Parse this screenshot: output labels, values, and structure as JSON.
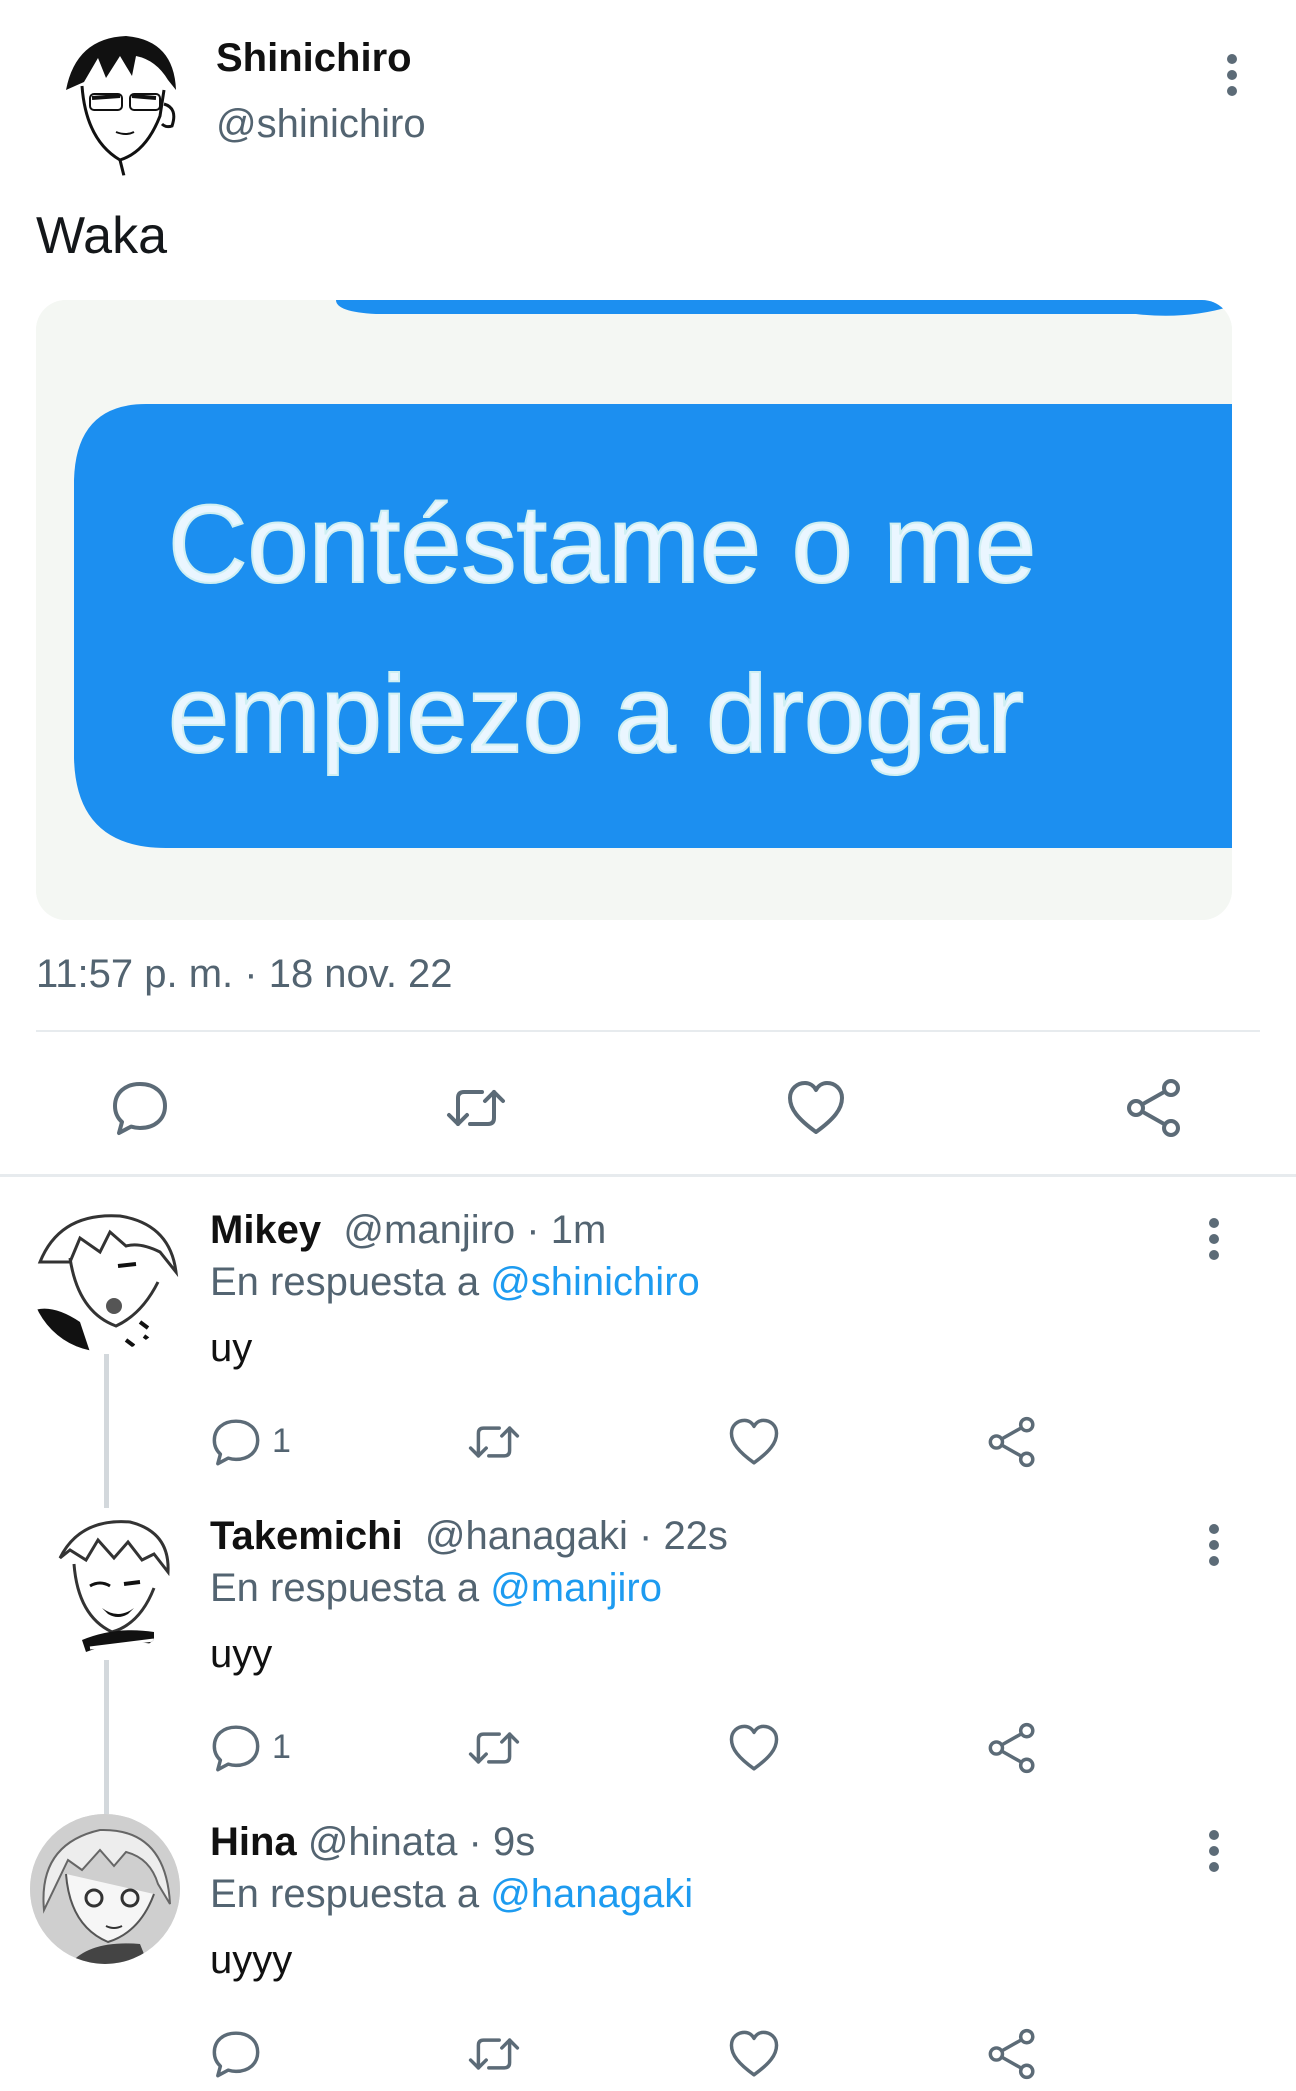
{
  "main_tweet": {
    "display_name": "Shinichiro",
    "handle": "@shinichiro",
    "text": "Waka",
    "image_text_line1": "Contéstame o me",
    "image_text_line2": "empiezo a drogar",
    "timestamp": "11:57 p. m. · 18 nov. 22"
  },
  "replies": [
    {
      "display_name": "Mikey",
      "handle_time": "@manjiro · 1m",
      "reply_label": "En respuesta a",
      "reply_to": "@shinichiro",
      "text": "uy",
      "reply_count": "1"
    },
    {
      "display_name": "Takemichi",
      "handle_time": "@hanagaki · 22s",
      "reply_label": "En respuesta a",
      "reply_to": "@manjiro",
      "text": "uyy",
      "reply_count": "1"
    },
    {
      "display_name": "Hina",
      "handle_time": "@hinata · 9s",
      "reply_label": "En respuesta a",
      "reply_to": "@hanagaki",
      "text": "uyyy",
      "reply_count": ""
    }
  ],
  "colors": {
    "accent": "#1d9bf0",
    "bubble": "#1c8ff0",
    "muted": "#536471",
    "icon": "#5c6b77"
  },
  "icons": [
    "more-vertical-icon",
    "reply-icon",
    "retweet-icon",
    "like-icon",
    "share-icon"
  ]
}
